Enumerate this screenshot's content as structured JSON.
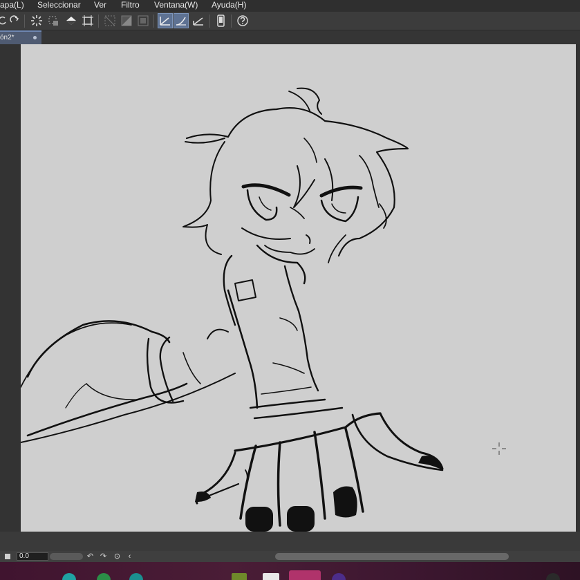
{
  "menu": [
    {
      "id": "capa",
      "label": "apa(L)"
    },
    {
      "id": "seleccionar",
      "label": "Seleccionar"
    },
    {
      "id": "ver",
      "label": "Ver"
    },
    {
      "id": "filtro",
      "label": "Filtro"
    },
    {
      "id": "ventana",
      "label": "Ventana(W)"
    },
    {
      "id": "ayuda",
      "label": "Ayuda(H)"
    }
  ],
  "toolbar": {
    "buttons": [
      "undo-icon",
      "redo-icon",
      "loading-icon",
      "selection-icon",
      "fill-icon",
      "crop-icon",
      "invert-selection-icon",
      "clear-outside-icon",
      "clear-inside-icon",
      "stabilizer-icon",
      "smoothing-brush-icon",
      "ruler-snap-icon",
      "device-icon",
      "help-icon"
    ],
    "active": [
      "stabilizer-icon",
      "smoothing-brush-icon"
    ]
  },
  "tab": {
    "title": "ón2*"
  },
  "status": {
    "zoom_value": "0.0"
  },
  "colors": {
    "canvas": "#cfcfcf",
    "active_button": "#5e7293",
    "tab_active": "#4f5b72"
  },
  "taskbar": {
    "icons": [
      "app-icon-teal",
      "app-icon-green",
      "app-icon-teal-2",
      "app-icon-olive",
      "app-icon-white",
      "app-icon-pink",
      "app-icon-purple",
      "app-icon-dark"
    ]
  }
}
